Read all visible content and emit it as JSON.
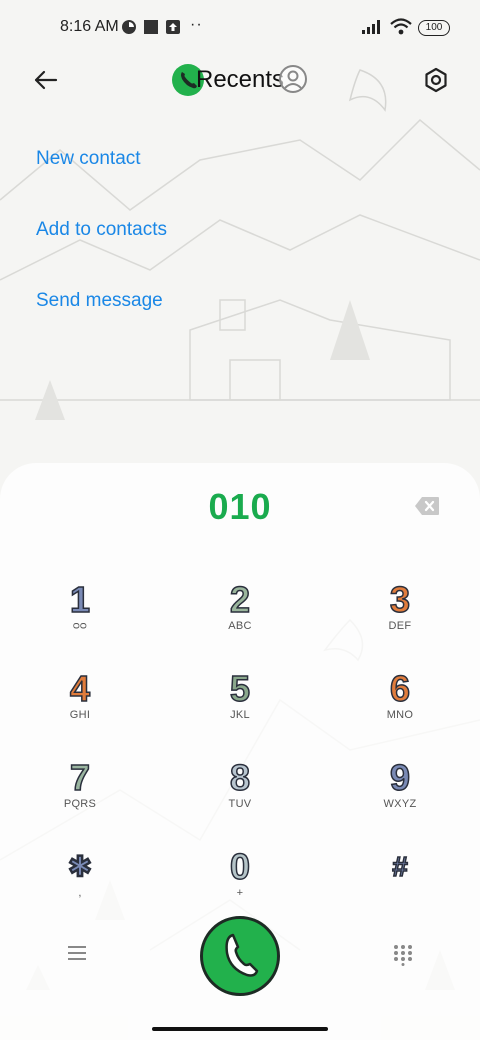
{
  "status_bar": {
    "time": "8:16 AM",
    "dots": "··",
    "battery": "100"
  },
  "header": {
    "title": "Recents"
  },
  "actions": {
    "new_contact": "New contact",
    "add_to_contacts": "Add to contacts",
    "send_message": "Send message"
  },
  "dialer": {
    "number": "010",
    "keys": [
      {
        "digit": "1",
        "sub": "ᴑᴑ"
      },
      {
        "digit": "2",
        "sub": "ABC"
      },
      {
        "digit": "3",
        "sub": "DEF"
      },
      {
        "digit": "4",
        "sub": "GHI"
      },
      {
        "digit": "5",
        "sub": "JKL"
      },
      {
        "digit": "6",
        "sub": "MNO"
      },
      {
        "digit": "7",
        "sub": "PQRS"
      },
      {
        "digit": "8",
        "sub": "TUV"
      },
      {
        "digit": "9",
        "sub": "WXYZ"
      },
      {
        "digit": "✱",
        "sub": ","
      },
      {
        "digit": "0",
        "sub": "+"
      },
      {
        "digit": "#",
        "sub": ""
      }
    ]
  },
  "icons": {
    "back": "back-arrow-icon",
    "phone": "phone-icon",
    "profile": "profile-icon",
    "settings": "settings-icon",
    "backspace": "backspace-icon",
    "menu": "menu-icon",
    "call": "call-icon",
    "dialpad": "dialpad-icon"
  },
  "colors": {
    "accent_blue": "#1a87e6",
    "dial_green": "#1aab4e",
    "call_green": "#22b14c"
  }
}
